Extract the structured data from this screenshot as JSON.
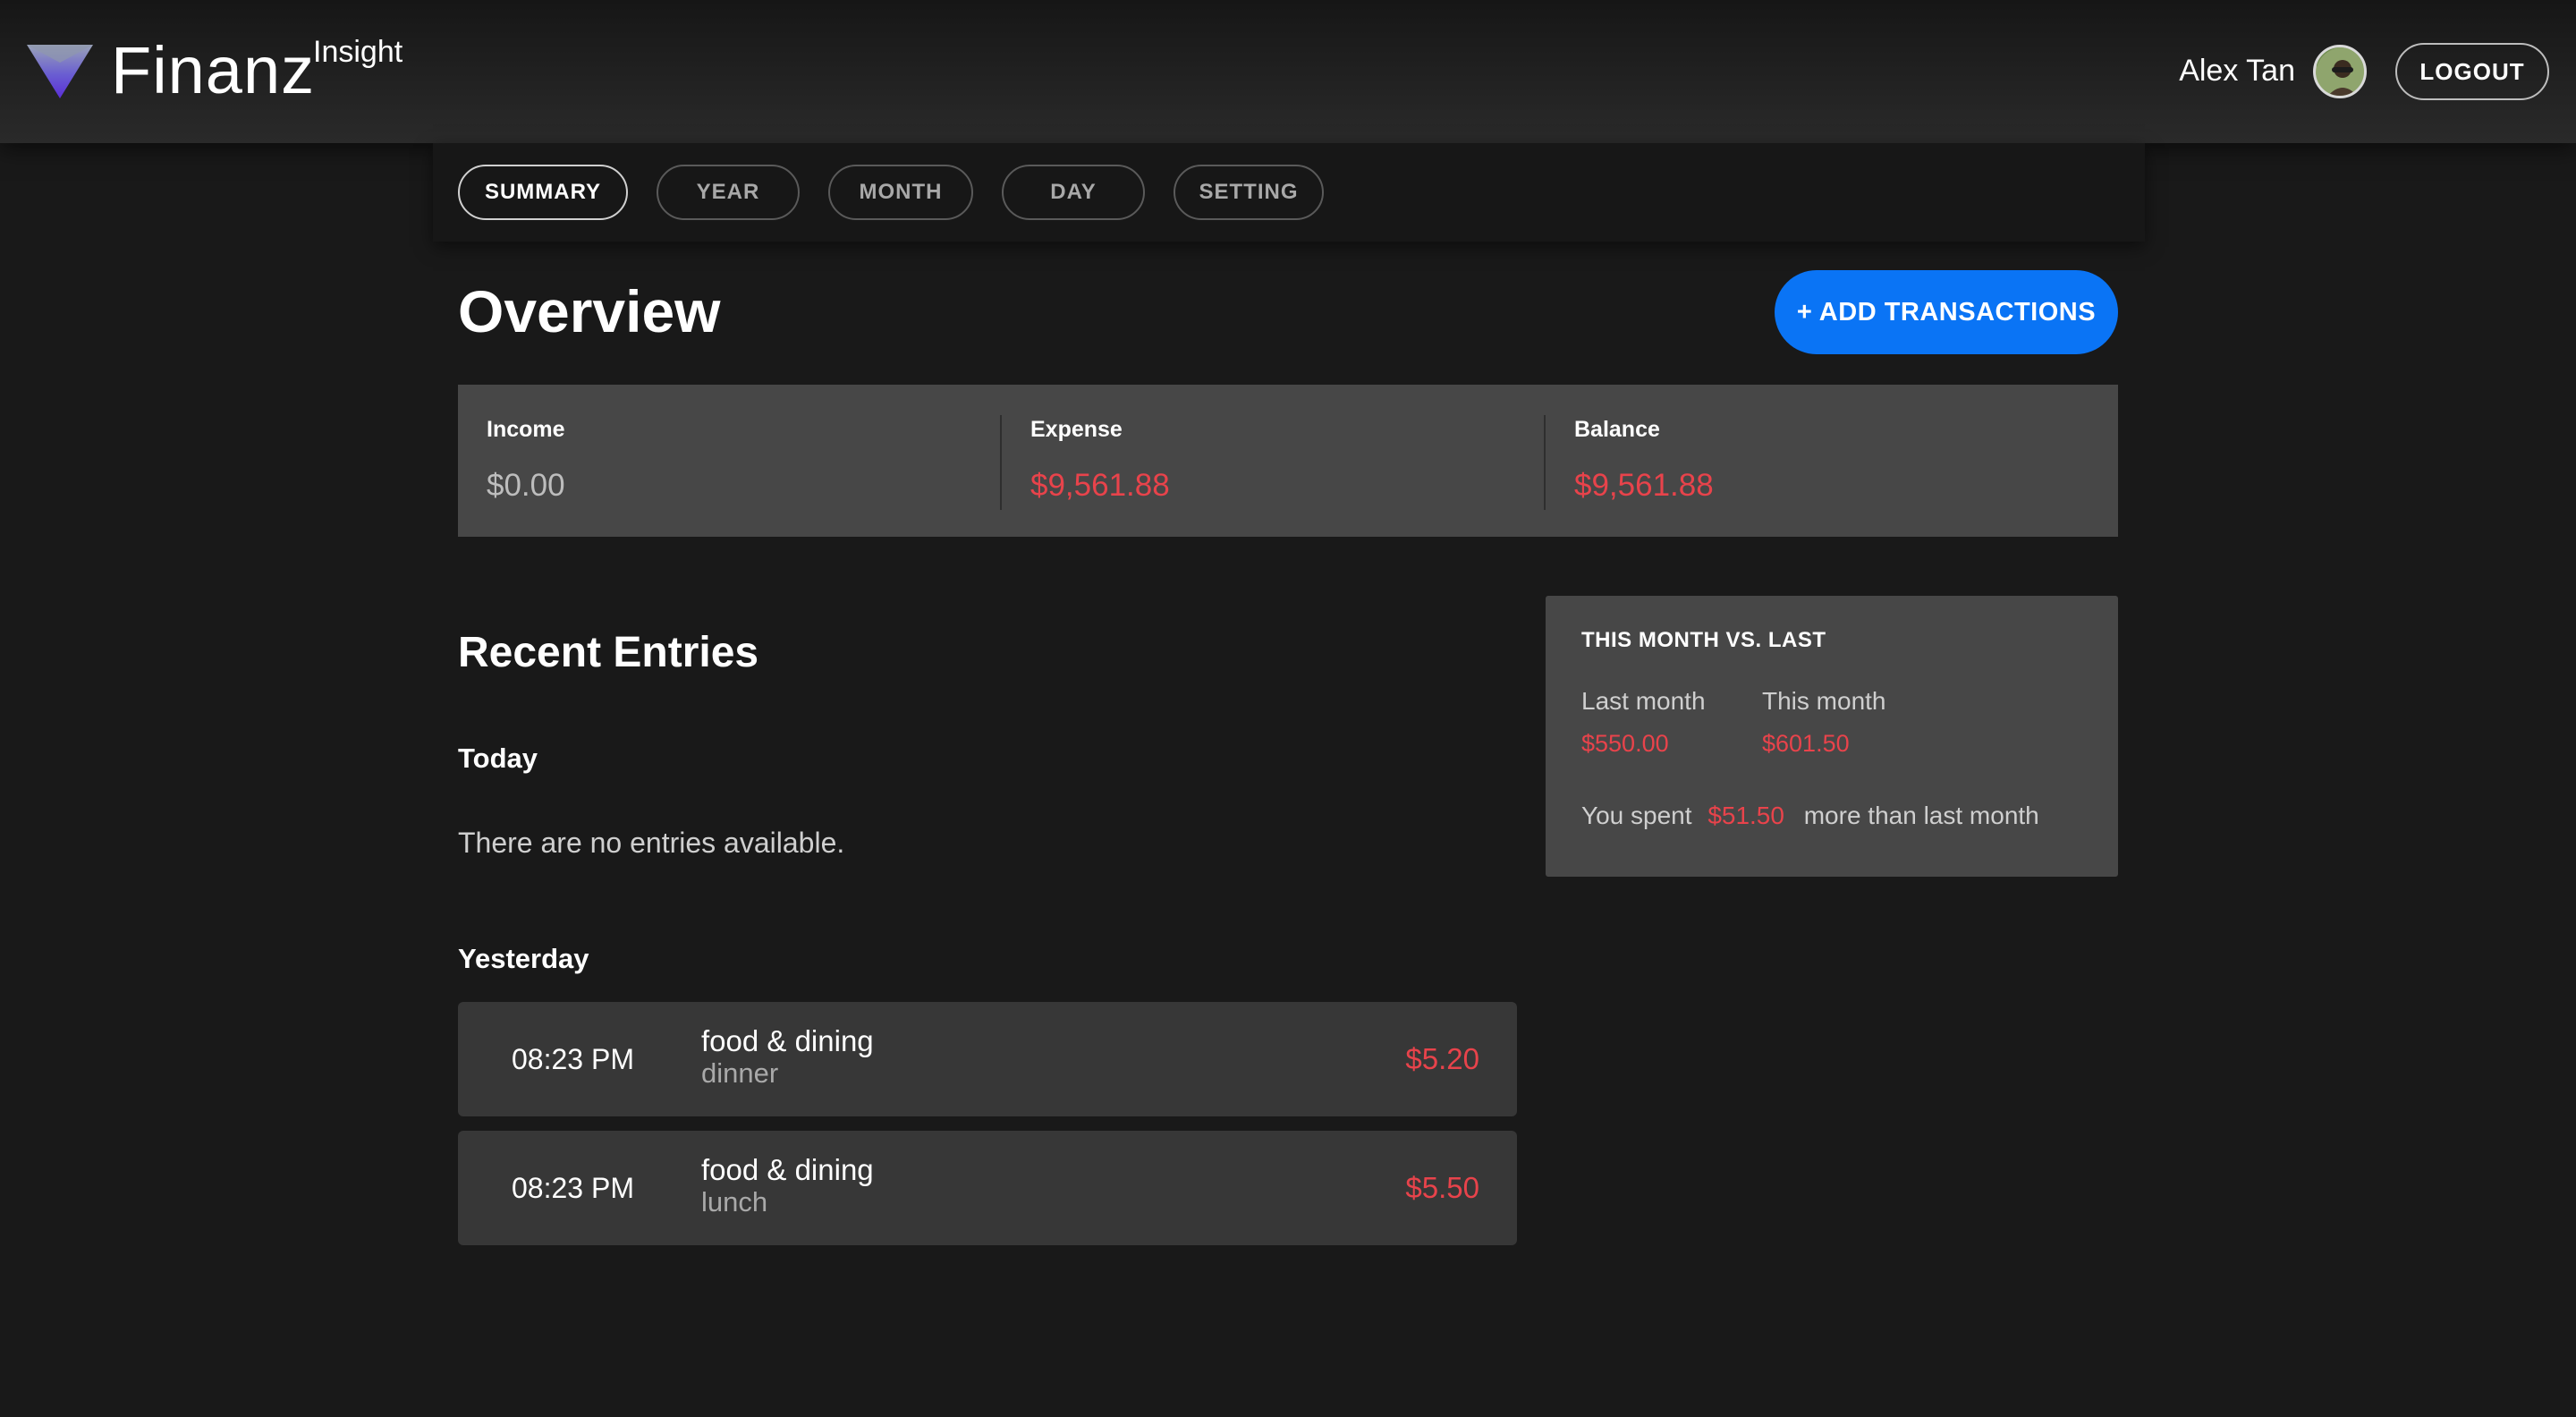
{
  "header": {
    "brand": "Finanz",
    "brand_sub": "Insight",
    "user_name": "Alex Tan",
    "logout_label": "LOGOUT"
  },
  "tabs": [
    {
      "label": "SUMMARY",
      "active": true
    },
    {
      "label": "YEAR",
      "active": false
    },
    {
      "label": "MONTH",
      "active": false
    },
    {
      "label": "DAY",
      "active": false
    },
    {
      "label": "SETTING",
      "active": false
    }
  ],
  "overview": {
    "title": "Overview",
    "add_label": "+ ADD TRANSACTIONS",
    "stats": [
      {
        "label": "Income",
        "value": "$0.00"
      },
      {
        "label": "Expense",
        "value": "$9,561.88"
      },
      {
        "label": "Balance",
        "value": "$9,561.88"
      }
    ]
  },
  "recent": {
    "title": "Recent Entries",
    "today_label": "Today",
    "empty_message": "There are no entries available.",
    "yesterday_label": "Yesterday",
    "entries": [
      {
        "time": "08:23 PM",
        "category": "food & dining",
        "note": "dinner",
        "amount": "$5.20"
      },
      {
        "time": "08:23 PM",
        "category": "food & dining",
        "note": "lunch",
        "amount": "$5.50"
      }
    ]
  },
  "compare": {
    "title": "THIS MONTH VS. LAST",
    "last_label": "Last month",
    "last_value": "$550.00",
    "this_label": "This month",
    "this_value": "$601.50",
    "summary_prefix": "You spent",
    "summary_amount": "$51.50",
    "summary_suffix": "more than last month"
  },
  "colors": {
    "accent": "#0a74f5",
    "negative": "#e8434b",
    "background": "#191919",
    "card": "#474747"
  }
}
